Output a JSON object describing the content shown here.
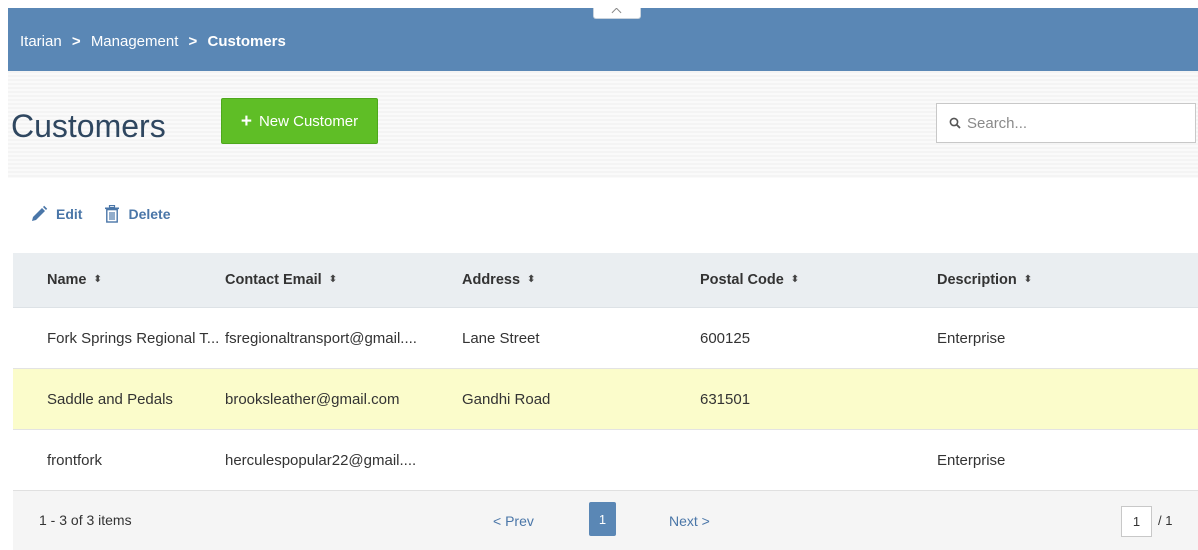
{
  "breadcrumb": {
    "items": [
      "Itarian",
      "Management"
    ],
    "separator": ">",
    "current": "Customers"
  },
  "page": {
    "title": "Customers",
    "new_button_label": "New Customer"
  },
  "search": {
    "placeholder": "Search..."
  },
  "toolbar": {
    "edit_label": "Edit",
    "delete_label": "Delete"
  },
  "table": {
    "columns": [
      "Name",
      "Contact Email",
      "Address",
      "Postal Code",
      "Description"
    ],
    "sort_indicator": "⬍",
    "rows": [
      {
        "name": "Fork Springs Regional T...",
        "email": "fsregionaltransport@gmail....",
        "address": "Lane Street",
        "postal_code": "600125",
        "description": "Enterprise"
      },
      {
        "name": "Saddle and Pedals",
        "email": "brooksleather@gmail.com",
        "address": "Gandhi Road",
        "postal_code": "631501",
        "description": ""
      },
      {
        "name": "frontfork",
        "email": "herculespopular22@gmail....",
        "address": "",
        "postal_code": "",
        "description": "Enterprise"
      }
    ]
  },
  "pager": {
    "summary": "1 - 3 of 3 items",
    "prev_label": "< Prev",
    "current_page": "1",
    "next_label": "Next >",
    "page_input_value": "1",
    "total_pages": "/ 1"
  },
  "colors": {
    "topbar": "#5a87b5",
    "primary_button": "#5fbe26",
    "link": "#4a76a8",
    "title": "#2f4760",
    "highlight_row": "#fbfccb"
  }
}
